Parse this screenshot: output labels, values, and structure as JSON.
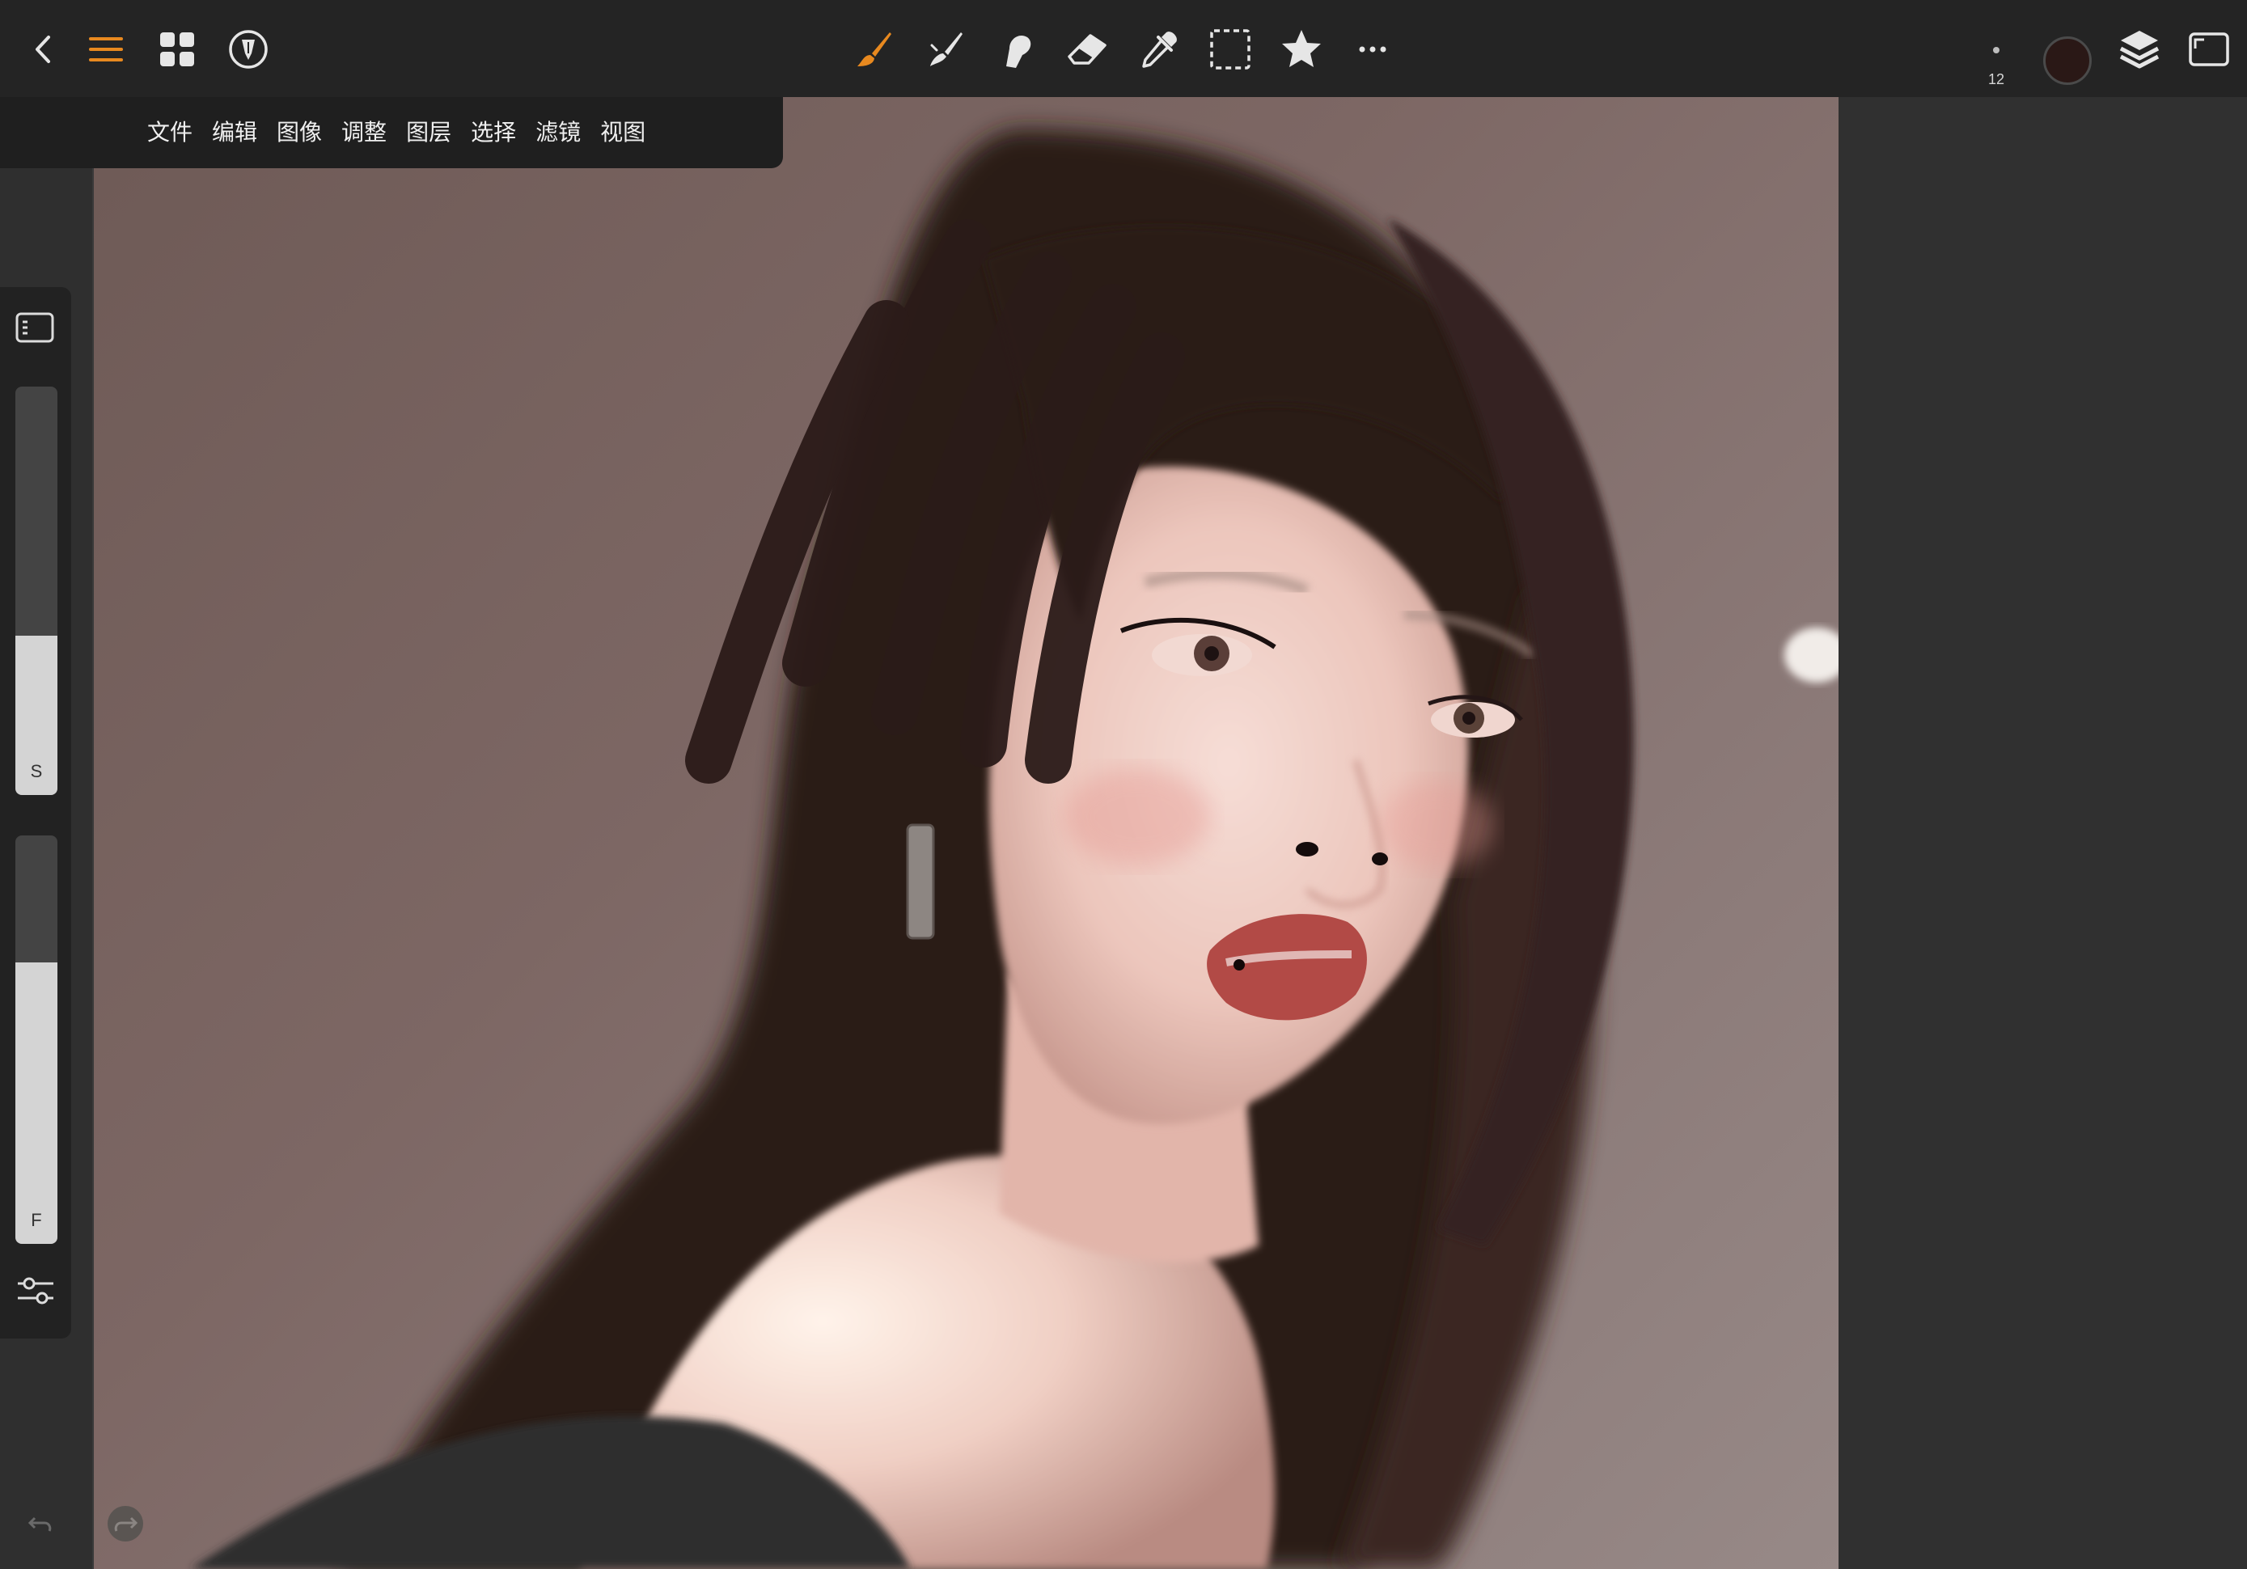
{
  "menu": {
    "items": [
      "文件",
      "编辑",
      "图像",
      "调整",
      "图层",
      "选择",
      "滤镜",
      "视图"
    ]
  },
  "toolbar": {
    "brush_size": "12",
    "current_color": "#2a1816",
    "accent_color": "#e8891f",
    "icons": {
      "back": "chevron-left-icon",
      "menu": "hamburger-menu-icon",
      "gallery": "grid-icon",
      "pen_mode": "pen-nib-icon",
      "brush": "paintbrush-icon",
      "smudge": "smudge-icon",
      "blur": "blur-finger-icon",
      "eraser": "eraser-icon",
      "eyedropper": "eyedropper-icon",
      "selection": "marquee-selection-icon",
      "favorites": "star-icon",
      "more": "more-icon",
      "layers": "layers-icon",
      "fullscreen": "fullscreen-icon"
    }
  },
  "side_panel": {
    "size_slider": {
      "label": "S",
      "level_fraction": 0.39
    },
    "flow_slider": {
      "label": "F",
      "level_fraction": 0.69
    }
  }
}
